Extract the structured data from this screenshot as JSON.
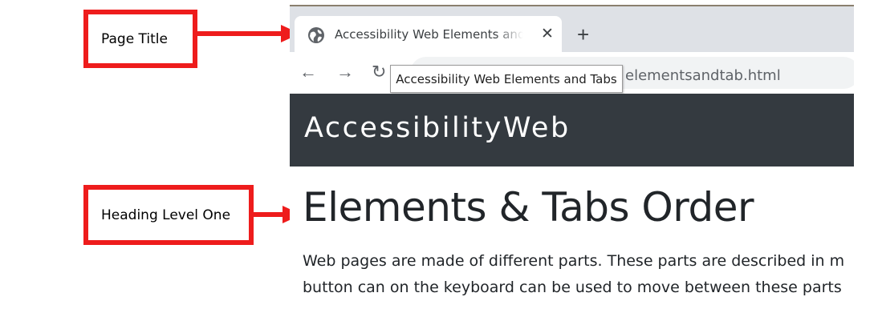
{
  "annotations": {
    "page_title_label": "Page Title",
    "heading_label": "Heading Level One",
    "accent_color": "#ee1c1c"
  },
  "browser": {
    "tab": {
      "title": "Accessibility Web Elements and Tabs",
      "favicon": "globe-icon",
      "close_icon": "close-icon"
    },
    "new_tab_icon": "plus-icon",
    "nav": {
      "back_icon": "arrow-left-icon",
      "forward_icon": "arrow-right-icon",
      "reload_icon": "reload-icon"
    },
    "url_visible": "elementsandtab.html",
    "tooltip": "Accessibility Web Elements and Tabs"
  },
  "page": {
    "brand": "AccessibilityWeb",
    "heading": "Elements & Tabs Order",
    "paragraph_lines": [
      "Web pages are made of different parts. These parts are described in m",
      "button can on the keyboard can be used to move between these parts"
    ],
    "navbar_color": "#343a40"
  }
}
